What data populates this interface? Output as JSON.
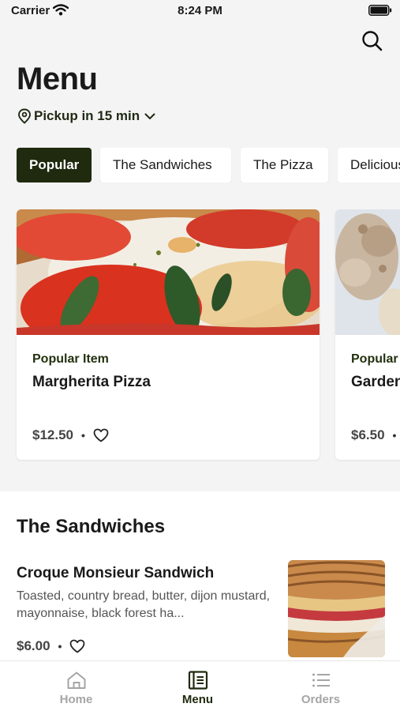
{
  "status": {
    "carrier": "Carrier",
    "time": "8:24 PM"
  },
  "header": {
    "title": "Menu",
    "pickup": "Pickup in 15 min"
  },
  "categories": [
    {
      "label": "Popular",
      "active": true
    },
    {
      "label": "The Sandwiches",
      "active": false
    },
    {
      "label": "The Pizza",
      "active": false
    },
    {
      "label": "Delicious",
      "active": false
    }
  ],
  "popular_cards": [
    {
      "tag": "Popular Item",
      "name": "Margherita Pizza",
      "price": "$12.50"
    },
    {
      "tag": "Popular",
      "name": "Garden",
      "price": "$6.50"
    }
  ],
  "sandwiches": {
    "title": "The Sandwiches",
    "items": [
      {
        "name": "Croque Monsieur Sandwich",
        "description": "Toasted, country bread, butter, dijon mustard, mayonnaise, black forest ha...",
        "price": "$6.00"
      }
    ]
  },
  "tabs": [
    {
      "label": "Home",
      "icon": "home-icon",
      "active": false
    },
    {
      "label": "Menu",
      "icon": "menu-icon",
      "active": true
    },
    {
      "label": "Orders",
      "icon": "orders-icon",
      "active": false
    }
  ],
  "colors": {
    "accent": "#1f2a0e",
    "background": "#f4f4f4",
    "card": "#ffffff",
    "inactive_tab": "#a5a5a5"
  }
}
